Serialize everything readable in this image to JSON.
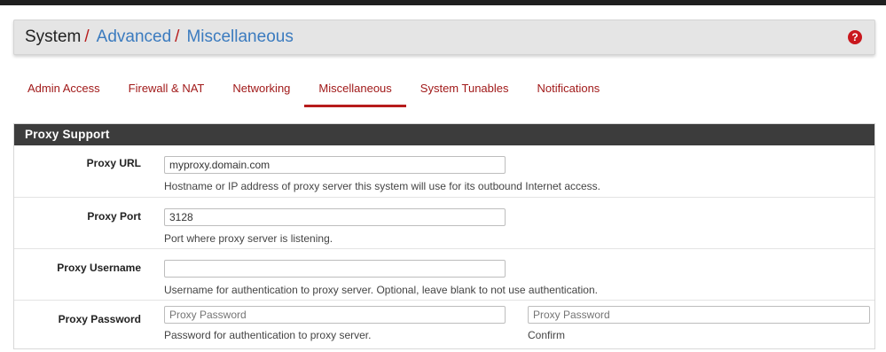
{
  "breadcrumb": {
    "root": "System",
    "sep": "/",
    "section": "Advanced",
    "page": "Miscellaneous"
  },
  "help_icon": "question-circle-icon",
  "tabs": [
    {
      "label": "Admin Access",
      "active": false
    },
    {
      "label": "Firewall & NAT",
      "active": false
    },
    {
      "label": "Networking",
      "active": false
    },
    {
      "label": "Miscellaneous",
      "active": true
    },
    {
      "label": "System Tunables",
      "active": false
    },
    {
      "label": "Notifications",
      "active": false
    }
  ],
  "colors": {
    "accent": "#b71c1c",
    "link": "#3b7bbf",
    "panel_heading_bg": "#3c3c3c"
  },
  "proxy_support": {
    "heading": "Proxy Support",
    "url": {
      "label": "Proxy URL",
      "value": "myproxy.domain.com",
      "help": "Hostname or IP address of proxy server this system will use for its outbound Internet access."
    },
    "port": {
      "label": "Proxy Port",
      "value": "3128",
      "help": "Port where proxy server is listening."
    },
    "username": {
      "label": "Proxy Username",
      "value": "",
      "help": "Username for authentication to proxy server. Optional, leave blank to not use authentication."
    },
    "password": {
      "label": "Proxy Password",
      "placeholder": "Proxy Password",
      "help": "Password for authentication to proxy server.",
      "confirm_placeholder": "Proxy Password",
      "confirm_help": "Confirm"
    }
  }
}
